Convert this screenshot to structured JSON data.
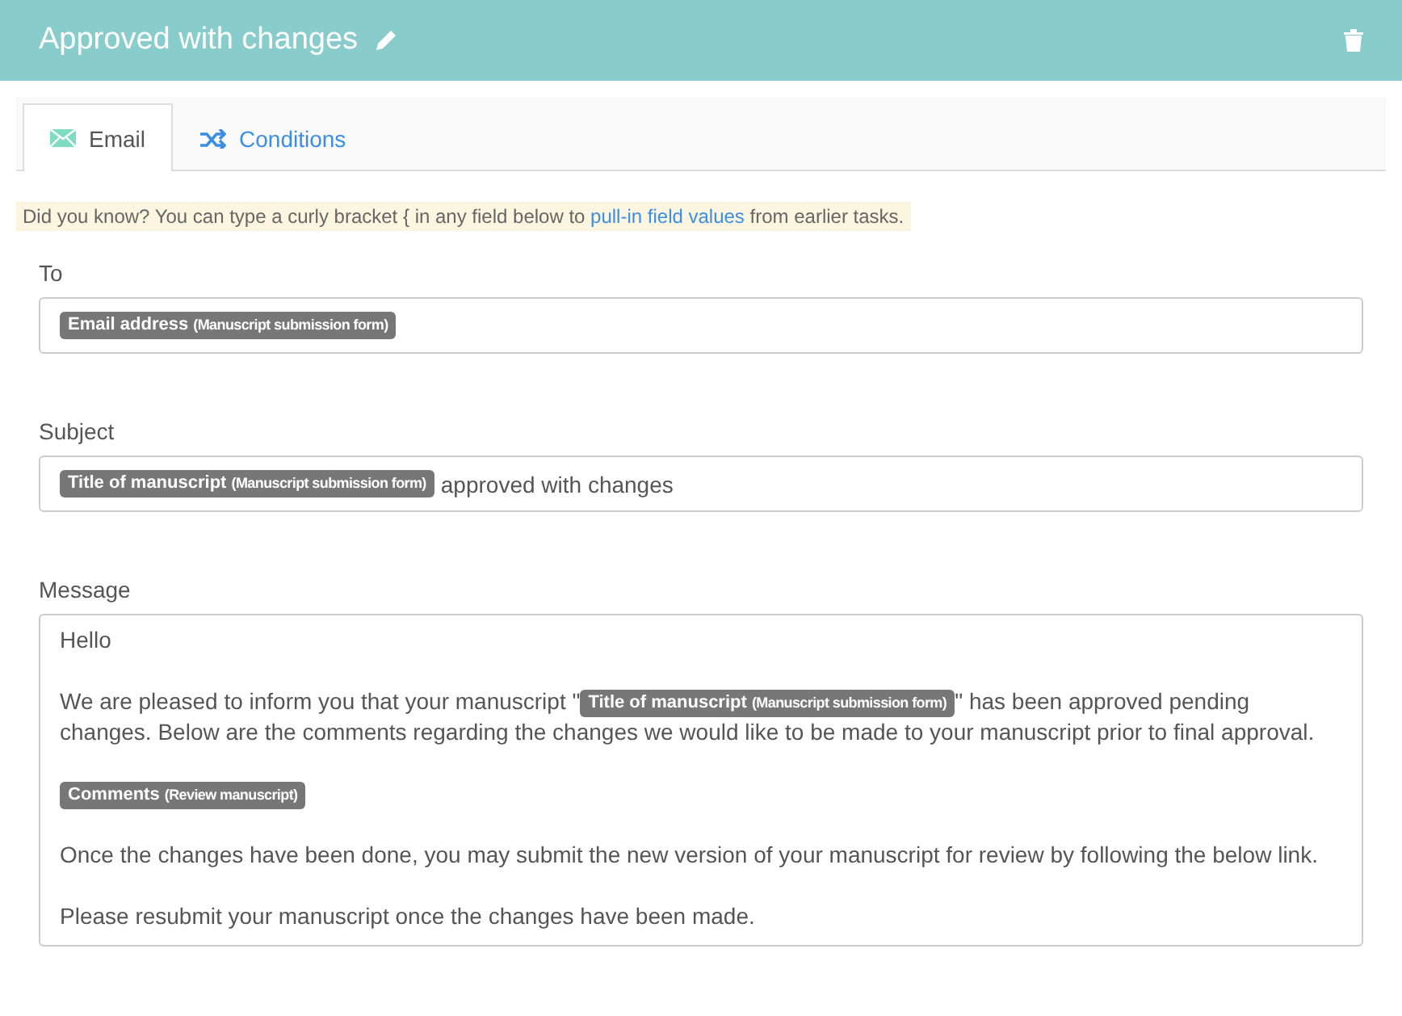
{
  "header": {
    "title": "Approved with changes"
  },
  "tabs": [
    {
      "label": "Email",
      "selected": true
    },
    {
      "label": "Conditions",
      "selected": false
    }
  ],
  "tip": [
    {
      "kind": "text",
      "text": "Did you know? You can type a curly bracket { in any field below to "
    },
    {
      "kind": "link",
      "text": "pull-in field values"
    },
    {
      "kind": "text",
      "text": " from earlier tasks."
    }
  ],
  "fields": [
    {
      "label": "To",
      "kind": "line",
      "paragraphs": [
        [
          {
            "kind": "token",
            "name": "Email address",
            "source": "(Manuscript submission form)"
          }
        ]
      ]
    },
    {
      "label": "Subject",
      "kind": "line",
      "paragraphs": [
        [
          {
            "kind": "token",
            "name": "Title of manuscript",
            "source": "(Manuscript submission form)"
          },
          {
            "kind": "text",
            "text": "approved with changes"
          }
        ]
      ]
    },
    {
      "label": "Message",
      "kind": "area",
      "paragraphs": [
        [
          {
            "kind": "text",
            "text": "Hello"
          }
        ],
        [
          {
            "kind": "text",
            "text": "We are pleased to inform you that your manuscript \""
          },
          {
            "kind": "token",
            "name": "Title of manuscript",
            "source": "(Manuscript submission form)"
          },
          {
            "kind": "text",
            "text": "\" has been approved pending"
          },
          {
            "kind": "line",
            "text": "changes. Below are the comments regarding the changes we would like to be made to your manuscript prior to final approval."
          }
        ],
        [
          {
            "kind": "token",
            "name": "Comments",
            "source": "(Review manuscript)"
          }
        ],
        [
          {
            "kind": "text",
            "text": "Once the changes have been done, you may submit the new version of your manuscript for review by following the below link."
          }
        ],
        [
          {
            "kind": "text",
            "text": "Please resubmit your manuscript once the changes have been made."
          }
        ]
      ]
    }
  ]
}
